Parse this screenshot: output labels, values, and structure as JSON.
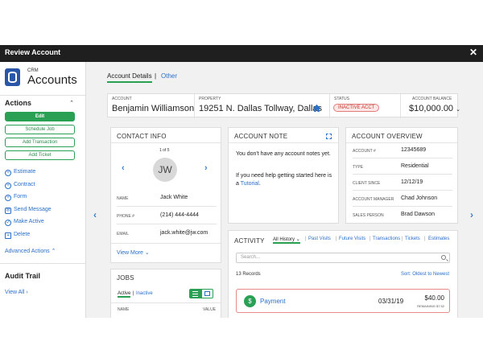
{
  "window": {
    "title": "Review Account",
    "close": "✕"
  },
  "sidebar": {
    "crm_label": "CRM",
    "app_name": "Accounts",
    "actions_heading": "Actions",
    "buttons": [
      "Edit",
      "Schedule Job",
      "Add Transaction",
      "Add Ticket"
    ],
    "links": [
      {
        "icon": "plus",
        "label": "Estimate"
      },
      {
        "icon": "plus",
        "label": "Contract"
      },
      {
        "icon": "plus",
        "label": "Form"
      },
      {
        "icon": "message",
        "label": "Send Message"
      },
      {
        "icon": "check",
        "label": "Make Active"
      },
      {
        "icon": "trash",
        "label": "Delete"
      }
    ],
    "advanced_actions": "Advanced Actions",
    "audit_heading": "Audit Trail",
    "view_all": "View All"
  },
  "tabs": {
    "active": "Account Details",
    "separator": "|",
    "other": "Other"
  },
  "infobar": {
    "account_label": "ACCOUNT",
    "account_value": "Benjamin Williamson",
    "property_label": "PROPERTY",
    "property_value": "19251 N. Dallas Tollway, Dallas",
    "status_label": "STATUS",
    "status_value": "INACTIVE ACCT",
    "balance_label": "ACCOUNT BALANCE",
    "balance_value": "$10,000.00"
  },
  "contact": {
    "title": "CONTACT INFO",
    "pager": "1 of 5",
    "initials": "JW",
    "name_label": "NAME",
    "name": "Jack White",
    "phone_label": "PHONE #",
    "phone": "(214) 444-4444",
    "email_label": "EMAIL",
    "email": "jack.white@jw.com",
    "view_more": "View More"
  },
  "note": {
    "title": "ACCOUNT NOTE",
    "text": "You don't have any account notes yet.",
    "help_prefix": "If you need help getting started here is a",
    "help_link": "Tutorial",
    "help_suffix": "."
  },
  "overview": {
    "title": "ACCOUNT OVERVIEW",
    "rows": [
      {
        "label": "ACCOUNT #",
        "value": "12345689"
      },
      {
        "label": "TYPE",
        "value": "Residential"
      },
      {
        "label": "CLIENT SINCE",
        "value": "12/12/19"
      },
      {
        "label": "ACCOUNT MANAGER",
        "value": "Chad Johnson"
      },
      {
        "label": "SALES PERSON",
        "value": "Brad Dawson"
      }
    ]
  },
  "jobs": {
    "title": "JOBS",
    "active": "Active",
    "sep": "|",
    "inactive": "Inactive",
    "col_name": "NAME",
    "col_value": "VALUE"
  },
  "activity": {
    "title": "ACTIVITY",
    "tabs": [
      "All History",
      "Past Visits",
      "Future Visits",
      "Transactions",
      "Tickets",
      "Estimates"
    ],
    "search_placeholder": "Search...",
    "records": "13 Records",
    "sort": "Sort: Oldest to Newest",
    "item": {
      "type": "Payment",
      "date": "03/31/19",
      "amount": "$40.00",
      "remaining": "REMAINING $7.52"
    }
  },
  "colors": {
    "accent_green": "#2aa055",
    "link_blue": "#2a6fc9",
    "brand_blue": "#2a56a8",
    "status_red": "#c0392b"
  }
}
